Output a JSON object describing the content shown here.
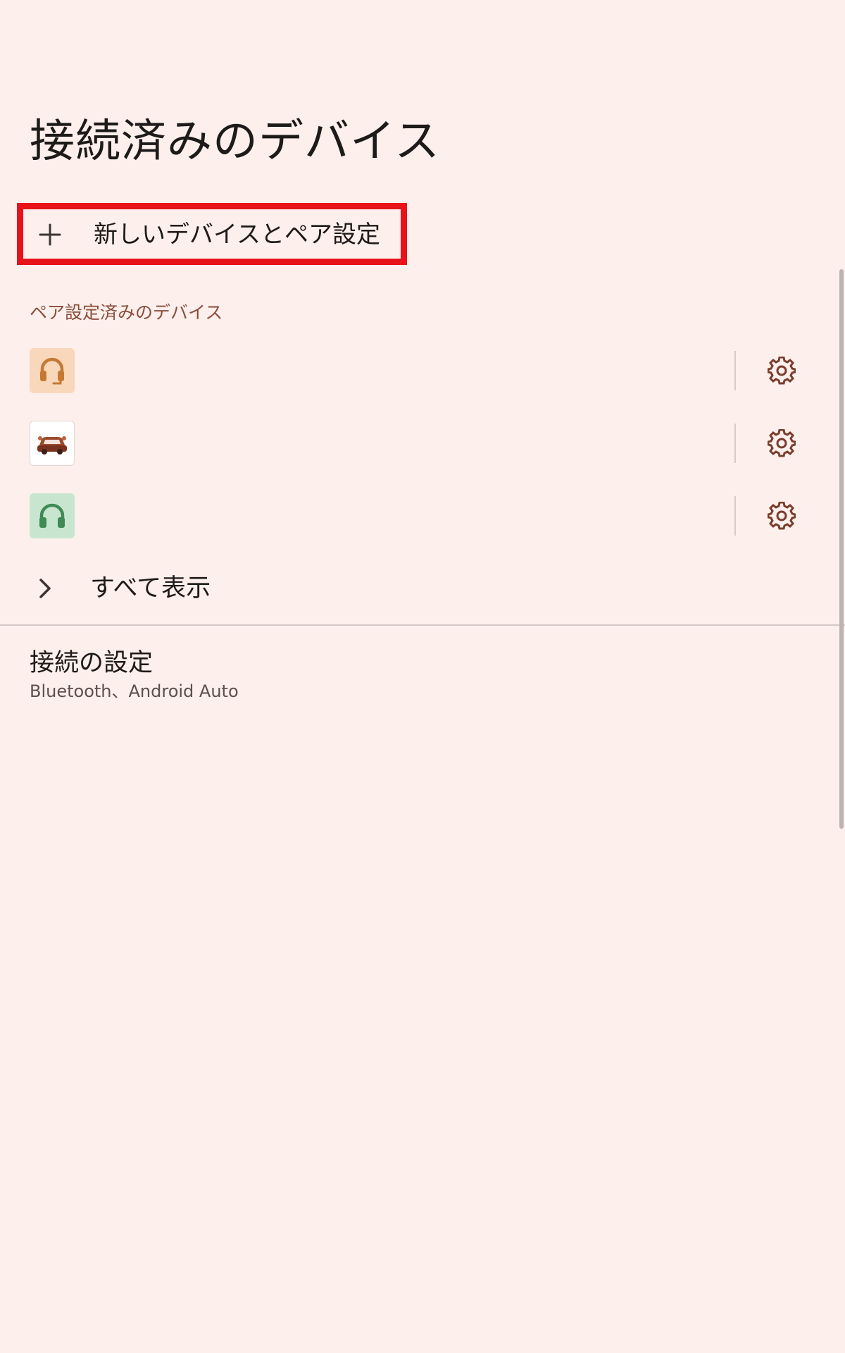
{
  "header": {
    "title": "接続済みのデバイス"
  },
  "pair_new": {
    "label": "新しいデバイスとペア設定",
    "icon": "plus-icon"
  },
  "paired_section": {
    "header": "ペア設定済みのデバイス",
    "devices": [
      {
        "icon": "headset-icon",
        "icon_color": "#c47a33",
        "thumb_color": "#f9d7bb",
        "action_icon": "gear-icon"
      },
      {
        "icon": "car-icon",
        "icon_color": "#8c3a22",
        "thumb_color": "#ffffff",
        "action_icon": "gear-icon"
      },
      {
        "icon": "headphones-icon",
        "icon_color": "#3f8a55",
        "thumb_color": "#c8e6cf",
        "action_icon": "gear-icon"
      }
    ]
  },
  "show_all": {
    "label": "すべて表示",
    "icon": "chevron-right-icon"
  },
  "connection_prefs": {
    "title": "接続の設定",
    "summary": "Bluetooth、Android Auto"
  },
  "colors": {
    "background": "#fcefec",
    "accent_text": "#8a4d3a",
    "highlight_border": "#e8121b",
    "gear": "#7a3d2c"
  }
}
